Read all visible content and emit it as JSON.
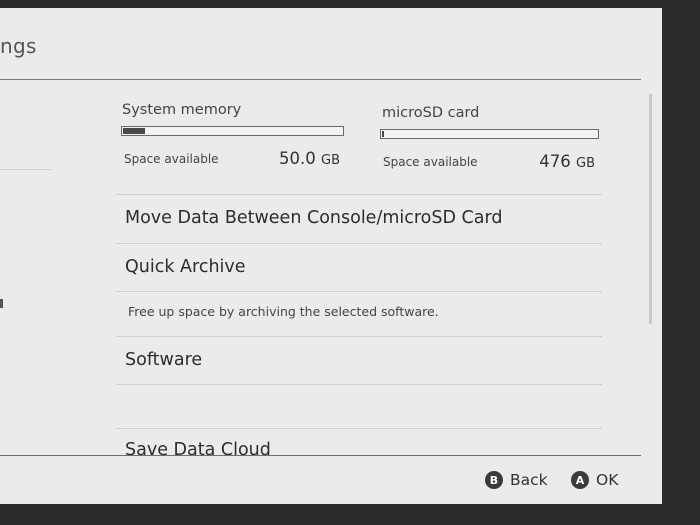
{
  "header": {
    "title": "ngs"
  },
  "storage": {
    "system_memory": {
      "label": "System memory",
      "space_label": "Space available",
      "value": "50.0",
      "unit": "GB",
      "used_fraction": 0.1
    },
    "microsd": {
      "label": "microSD card",
      "space_label": "Space available",
      "value": "476",
      "unit": "GB",
      "used_fraction": 0.01
    }
  },
  "menu": {
    "move_data": "Move Data Between Console/microSD Card",
    "quick_archive": "Quick Archive",
    "quick_archive_desc": "Free up space by archiving the selected software.",
    "software": "Software",
    "save_data_cloud": "Save Data Cloud"
  },
  "footer": {
    "back_key": "B",
    "back_label": "Back",
    "ok_key": "A",
    "ok_label": "OK"
  }
}
